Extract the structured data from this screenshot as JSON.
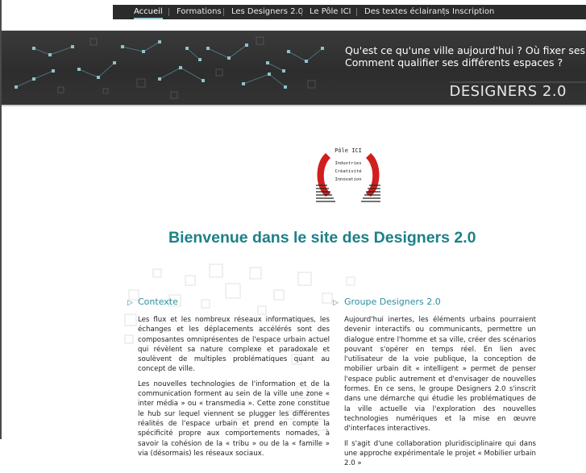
{
  "nav": {
    "items": [
      {
        "label": "Accueil",
        "active": true
      },
      {
        "label": "Formations",
        "active": false
      },
      {
        "label": "Les Designers 2.0",
        "active": false
      },
      {
        "label": "Le Pôle ICI",
        "active": false
      },
      {
        "label": "Des textes éclairants",
        "active": false
      },
      {
        "label": "Inscription",
        "active": false
      }
    ]
  },
  "banner": {
    "question_1": "Qu'est ce qu'une ville aujourd'hui ? Où fixer ses limites ?",
    "question_2": "Comment qualifier ses différents espaces ?",
    "brand": "DESIGNERS 2.0"
  },
  "logo": {
    "title": "Pôle ICI",
    "line_1": "Industries",
    "line_2": "Créativité",
    "line_3": "Innovation"
  },
  "welcome": "Bienvenue dans le site des Designers 2.0",
  "sections": {
    "contexte": {
      "heading": "Contexte",
      "paragraphs": [
        "Les flux et les nombreux réseaux informatiques, les échanges et les déplacements accélérés sont des composantes omniprésentes de l'espace urbain actuel qui révèlent sa nature complexe et paradoxale et soulèvent de multiples problématiques quant au concept de ville.",
        "Les nouvelles technologies de l'information et de la communication forment au sein de la ville une zone « inter média » ou « transmedia ». Cette zone constitue le hub sur lequel viennent se plugger les différentes réalités de l'espace urbain et prend en compte la spécificité propre aux comportements nomades, à savoir la cohésion de la « tribu » ou de la « famille » via (désormais) les réseaux sociaux."
      ]
    },
    "groupe": {
      "heading": "Groupe Designers 2.0",
      "paragraphs": [
        "Aujourd'hui inertes, les éléments urbains pourraient devenir interactifs ou communicants, permettre un dialogue entre l'homme et sa ville, créer des scénarios pouvant s'opérer en temps réel. En lien avec l'utilisateur de la voie publique, la conception de mobilier urbain dit « intelligent » permet de penser l'espace public autrement et d'envisager de nouvelles formes. En ce sens, le groupe Designers 2.0 s'inscrit dans une démarche qui étudie les problématiques de la ville actuelle via l'exploration des nouvelles technologies numériques et la mise en œuvre d'interfaces interactives.",
        "Il s'agit d'une collaboration pluridisciplinaire qui dans une approche expérimentale le projet « Mobilier urbain 2.0 »"
      ]
    }
  }
}
